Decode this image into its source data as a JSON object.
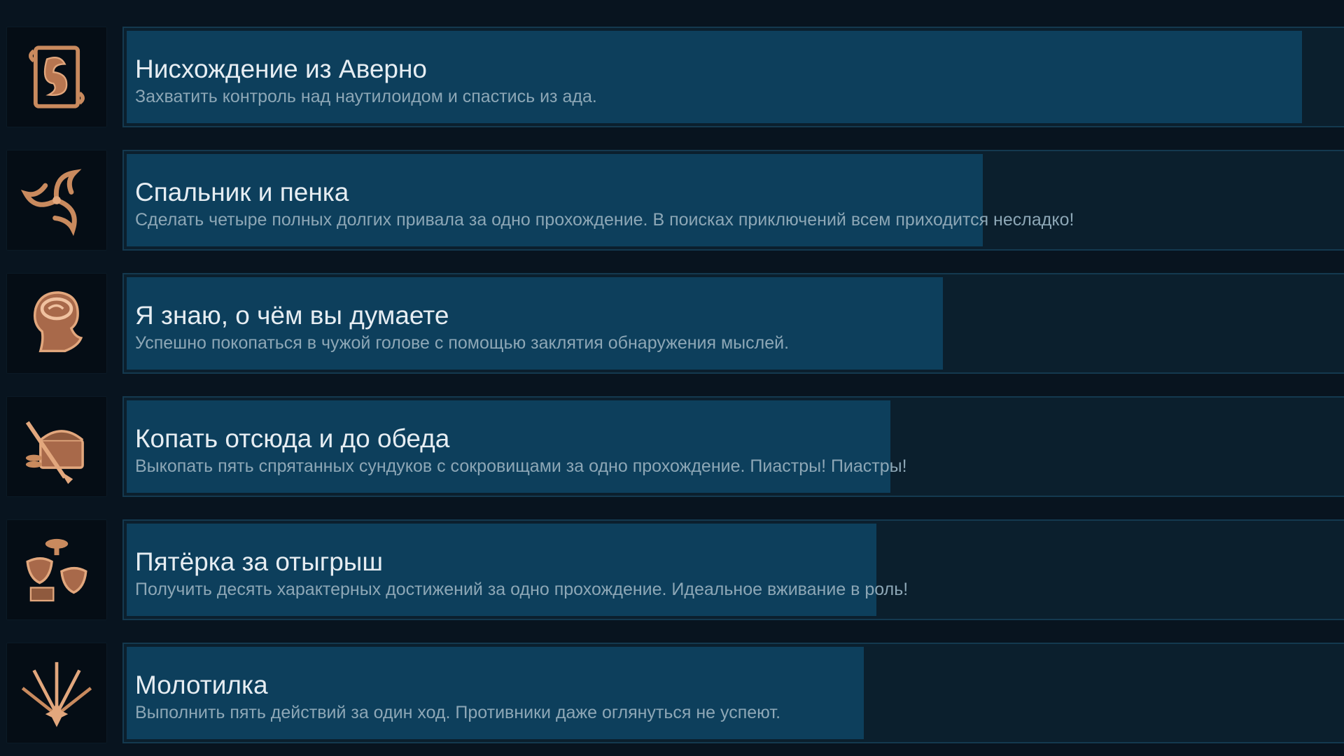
{
  "colors": {
    "background": "#08141f",
    "panel": "#0b1f2d",
    "panel_border": "#14394f",
    "progress_fill": "#0d3f5c",
    "title_text": "#e6edf2",
    "description_text": "#8da7b6",
    "icon_copper": "#c98a5e"
  },
  "achievements": [
    {
      "icon": "dragon-scroll-icon",
      "title": "Нисхождение из Аверно",
      "description": "Захватить контроль над наутилоидом и спастись из ада.",
      "progress_fraction": 0.79
    },
    {
      "icon": "crescent-triskelion-icon",
      "title": "Спальник и пенка",
      "description": "Сделать четыре полных долгих привала за одно прохождение. В поисках приключений всем приходится несладко!",
      "progress_fraction": 0.58
    },
    {
      "icon": "brain-head-icon",
      "title": "Я знаю, о чём вы думаете",
      "description": "Успешно покопаться в чужой голове с помощью заклятия обнаружения мыслей.",
      "progress_fraction": 0.55
    },
    {
      "icon": "treasure-shovel-icon",
      "title": "Копать отсюда и до обеда",
      "description": "Выкопать пять спрятанных сундуков с сокровищами за одно прохождение. Пиастры! Пиастры!",
      "progress_fraction": 0.51
    },
    {
      "icon": "party-masks-icon",
      "title": "Пятёрка за отыгрыш",
      "description": "Получить десять характерных достижений за одно прохождение. Идеальное вживание в роль!",
      "progress_fraction": 0.5
    },
    {
      "icon": "swords-burst-icon",
      "title": "Молотилка",
      "description": "Выполнить пять действий за один ход. Противники даже оглянуться не успеют.",
      "progress_fraction": 0.49
    }
  ]
}
